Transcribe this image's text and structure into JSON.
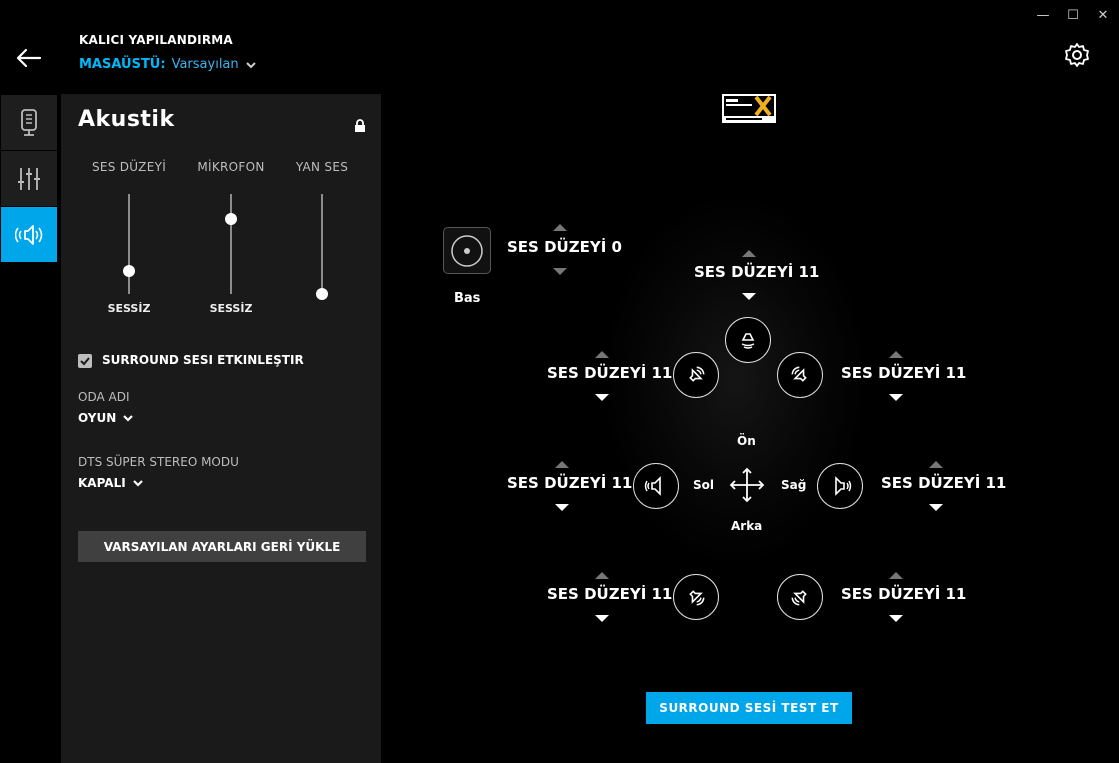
{
  "window": {
    "minimize": "—",
    "maximize": "☐",
    "close": "✕"
  },
  "header": {
    "title": "KALICI YAPILANDIRMA",
    "profile_name": "MASAÜSTÜ:",
    "profile_value": "Varsayılan"
  },
  "nav": {
    "items": [
      {
        "icon": "microphone-icon",
        "active": false
      },
      {
        "icon": "equalizer-icon",
        "active": false
      },
      {
        "icon": "acoustic-speaker-icon",
        "active": true
      }
    ]
  },
  "panel": {
    "title": "Akustik",
    "sliders": [
      {
        "label": "SES DÜZEYİ",
        "min_label": "SESSİZ",
        "level": 0.23
      },
      {
        "label": "MİKROFON",
        "min_label": "SESSİZ",
        "level": 0.75
      },
      {
        "label": "YAN SES",
        "min_label": "",
        "level": 0.0
      }
    ],
    "surround_checkbox": {
      "label": "SURROUND SESI ETKINLEŞTIR",
      "checked": true
    },
    "room": {
      "label": "ODA ADI",
      "value": "OYUN"
    },
    "dts_mode": {
      "label": "DTS SÜPER STEREO MODU",
      "value": "KAPALI"
    },
    "reset_label": "VARSAYILAN AYARLARI GERİ YÜKLE"
  },
  "surround": {
    "bass": {
      "level_text": "SES DÜZEYİ 0",
      "label": "Bas"
    },
    "center": {
      "level_text": "SES DÜZEYİ 11"
    },
    "front_left": {
      "level_text": "SES DÜZEYİ 11"
    },
    "front_right": {
      "level_text": "SES DÜZEYİ 11"
    },
    "side_left": {
      "level_text": "SES DÜZEYİ 11",
      "dir": "Sol"
    },
    "side_right": {
      "level_text": "SES DÜZEYİ 11",
      "dir": "Sağ"
    },
    "rear_left": {
      "level_text": "SES DÜZEYİ 11"
    },
    "rear_right": {
      "level_text": "SES DÜZEYİ 11"
    },
    "front_label": "Ön",
    "back_label": "Arka",
    "test_button": "SURROUND SESİ TEST ET"
  },
  "colors": {
    "accent": "#00a6ea",
    "panel": "#1a1a1a",
    "background": "#000000"
  }
}
